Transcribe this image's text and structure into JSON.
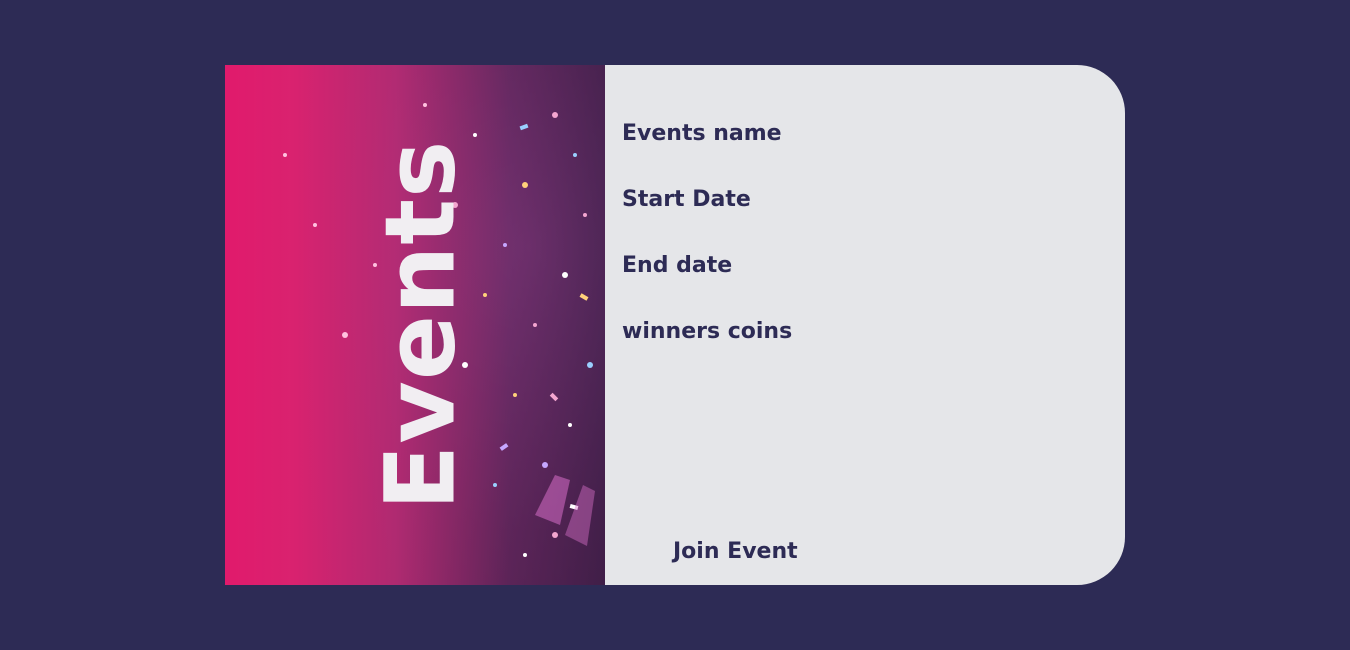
{
  "banner": {
    "title": "Events"
  },
  "event_card": {
    "fields": [
      "Events name",
      "Start Date",
      "End date",
      "winners coins"
    ],
    "join_label": "Join Event"
  },
  "colors": {
    "background": "#2d2b55",
    "card": "#e5e6e9",
    "text": "#2d2b55",
    "accent_pink": "#e11a6c"
  }
}
